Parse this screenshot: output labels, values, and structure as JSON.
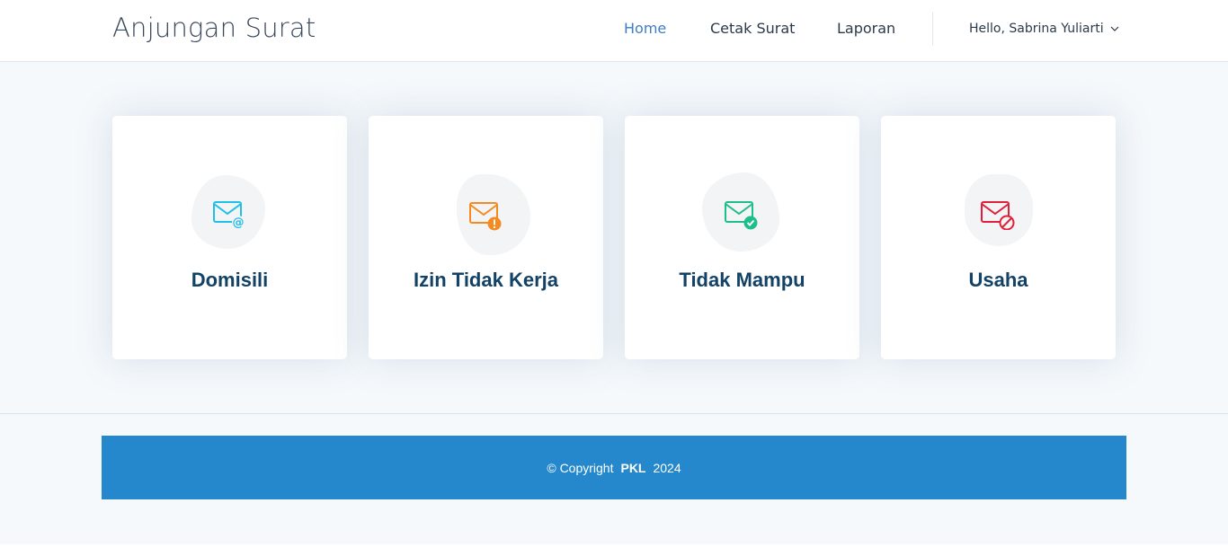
{
  "app": {
    "title": "Anjungan Surat"
  },
  "nav": {
    "items": [
      {
        "label": "Home",
        "active": true
      },
      {
        "label": "Cetak Surat",
        "active": false
      },
      {
        "label": "Laporan",
        "active": false
      }
    ],
    "user_greeting": "Hello, Sabrina Yuliarti"
  },
  "cards": [
    {
      "title": "Domisili",
      "icon": "mail-at-icon",
      "color": "#1fc0e8"
    },
    {
      "title": "Izin Tidak Kerja",
      "icon": "mail-warning-icon",
      "color": "#f58b20"
    },
    {
      "title": "Tidak Mampu",
      "icon": "mail-check-icon",
      "color": "#1cbf8a"
    },
    {
      "title": "Usaha",
      "icon": "mail-blocked-icon",
      "color": "#e0203a"
    }
  ],
  "footer": {
    "copyright_prefix": "© Copyright",
    "brand": "PKL",
    "year": "2024",
    "bar_color": "#2587cc"
  }
}
